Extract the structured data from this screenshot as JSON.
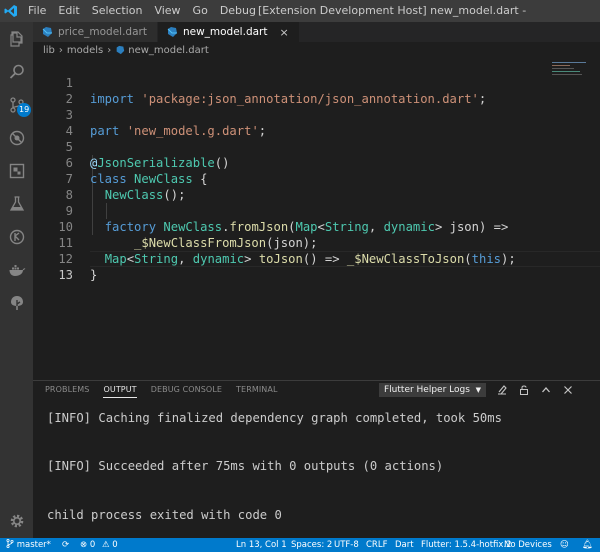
{
  "window": {
    "title": "[Extension Development Host] new_model.dart - bitcoin - Visual ...",
    "menu": [
      "File",
      "Edit",
      "Selection",
      "View",
      "Go",
      "Debug"
    ]
  },
  "activity_bar": {
    "source_control_badge": "19",
    "items": [
      "explorer-icon",
      "search-icon",
      "source-control-icon",
      "debug-icon",
      "extensions-icon",
      "test-icon",
      "git-icon",
      "docker-icon",
      "tree-icon"
    ],
    "bottom": "settings-gear-icon"
  },
  "tabs": [
    {
      "label": "price_model.dart",
      "active": false
    },
    {
      "label": "new_model.dart",
      "active": true,
      "close": "×"
    }
  ],
  "breadcrumb": [
    "lib",
    "models",
    "new_model.dart"
  ],
  "editor": {
    "line_numbers": [
      "1",
      "2",
      "3",
      "4",
      "5",
      "6",
      "7",
      "8",
      "9",
      "10",
      "11",
      "12",
      "13"
    ],
    "current_line": "13"
  },
  "panel": {
    "tabs": [
      "PROBLEMS",
      "OUTPUT",
      "DEBUG CONSOLE",
      "TERMINAL"
    ],
    "active_tab": "OUTPUT",
    "log_selector": "Flutter Helper Logs",
    "output_lines": [
      "[INFO] Caching finalized dependency graph completed, took 50ms",
      "[INFO] Succeeded after 75ms with 0 outputs (0 actions)",
      "child process exited with code 0"
    ]
  },
  "status_bar": {
    "branch": "master*",
    "errors": "0",
    "warnings": "0",
    "position": "Ln 13, Col 1",
    "spaces": "Spaces: 2",
    "encoding": "UTF-8",
    "eol": "CRLF",
    "language": "Dart",
    "flutter": "Flutter: 1.5.4-hotfix.2",
    "devices": "No Devices"
  },
  "colors": {
    "accent": "#007acc",
    "keyword": "#569cd6",
    "string": "#ce9178",
    "type": "#4ec9b0",
    "function": "#dcdcaa"
  }
}
